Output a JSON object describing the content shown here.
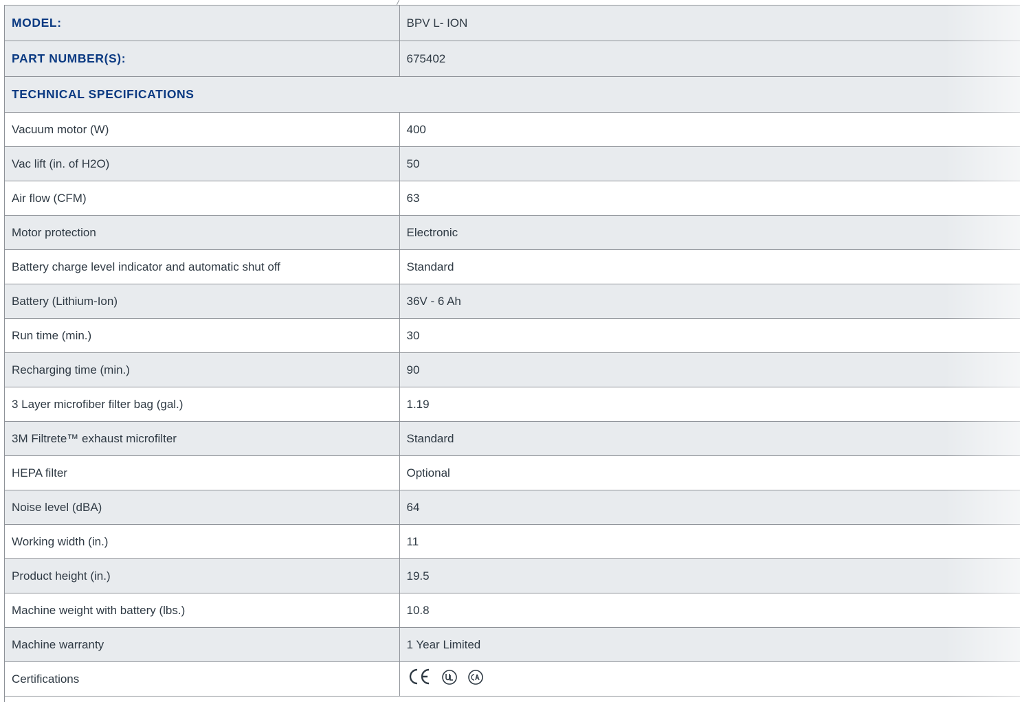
{
  "header": {
    "model_label": "MODEL:",
    "model_value": "BPV L- ION",
    "part_label": "PART NUMBER(S):",
    "part_value": "675402",
    "section_title": "TECHNICAL SPECIFICATIONS"
  },
  "specs": [
    {
      "label": "Vacuum motor (W)",
      "value": "400"
    },
    {
      "label": "Vac lift (in. of H2O)",
      "value": "50"
    },
    {
      "label": "Air flow (CFM)",
      "value": "63"
    },
    {
      "label": "Motor protection",
      "value": "Electronic"
    },
    {
      "label": "Battery charge level indicator and automatic shut off",
      "value": "Standard"
    },
    {
      "label": "Battery (Lithium-Ion)",
      "value": "36V - 6 Ah"
    },
    {
      "label": "Run time (min.)",
      "value": "30"
    },
    {
      "label": "Recharging time (min.)",
      "value": "90"
    },
    {
      "label": "3 Layer microfiber filter bag (gal.)",
      "value": "1.19"
    },
    {
      "label": "3M Filtrete™ exhaust microfilter",
      "value": "Standard"
    },
    {
      "label": "HEPA filter",
      "value": "Optional"
    },
    {
      "label": "Noise level (dBA)",
      "value": "64"
    },
    {
      "label": "Working width (in.)",
      "value": "11"
    },
    {
      "label": "Product height (in.)",
      "value": "19.5"
    },
    {
      "label": "Machine weight with battery (lbs.)",
      "value": "10.8"
    },
    {
      "label": "Machine warranty",
      "value": "1 Year Limited"
    }
  ],
  "certifications": {
    "label": "Certifications",
    "marks": [
      "CE",
      "UL",
      "CSA"
    ]
  },
  "colors": {
    "heading_blue": "#0b3a82",
    "row_gray": "#e8ebee",
    "border": "#8e9298"
  }
}
